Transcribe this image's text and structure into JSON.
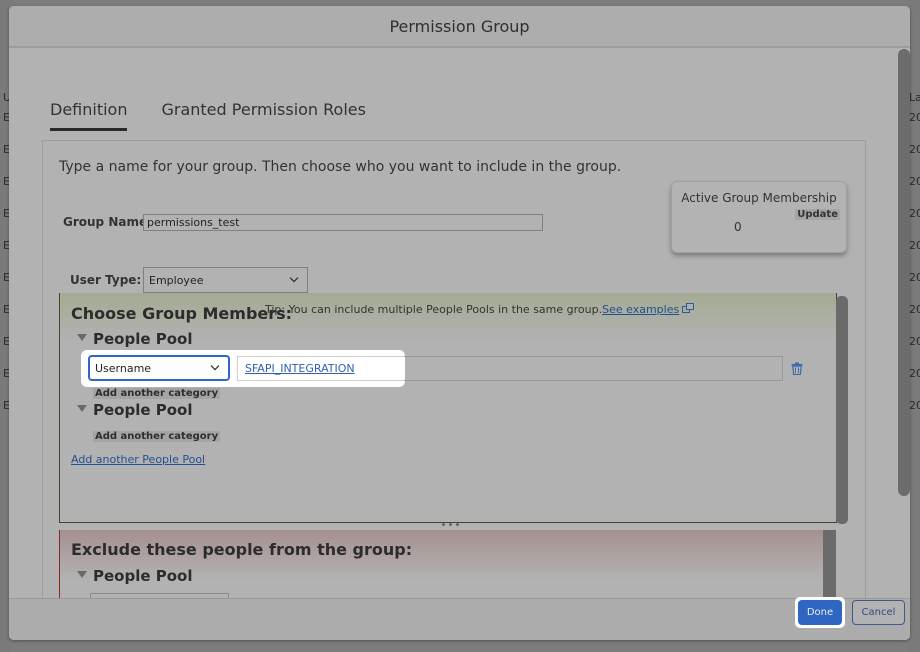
{
  "background": {
    "left_column": {
      "header": "U",
      "cells": [
        "E",
        "E",
        "E",
        "E",
        "E",
        "E",
        "E",
        "E",
        "E",
        "E"
      ]
    },
    "right_column": {
      "header": "La",
      "cells": [
        "20",
        "20",
        "20",
        "20",
        "20",
        "20",
        "20",
        "20",
        "20",
        "20"
      ]
    }
  },
  "dialog": {
    "title": "Permission Group",
    "tabs": [
      {
        "label": "Definition",
        "active": true
      },
      {
        "label": "Granted Permission Roles",
        "active": false
      }
    ],
    "intro": "Type a name for your group. Then choose who you want to include in the group.",
    "active_group_membership": {
      "title": "Active Group Membership",
      "update_label": "Update",
      "count": "0"
    },
    "group_name": {
      "label": "Group Name:",
      "value": "permissions_test"
    },
    "user_type": {
      "label": "User Type:",
      "selected": "Employee"
    },
    "include": {
      "heading": "Choose Group Members:",
      "tip": "Tip: You can include multiple People Pools in the same group.",
      "tip_link": "See examples",
      "pools": [
        {
          "title": "People Pool",
          "criteria": [
            {
              "category": "Username",
              "value": "SFAPI_INTEGRATION"
            }
          ],
          "add_category_label": "Add another category"
        },
        {
          "title": "People Pool",
          "criteria": [],
          "add_category_label": "Add another category"
        }
      ],
      "add_pool_label": "Add another People Pool"
    },
    "exclude": {
      "heading": "Exclude these people from the group:",
      "pools": [
        {
          "title": "People Pool"
        }
      ]
    },
    "footer": {
      "done_label": "Done",
      "cancel_label": "Cancel"
    }
  },
  "colors": {
    "primary": "#2f66c1",
    "link": "#234f93",
    "include_border": "#3a4a2c",
    "exclude_border": "#8a2a1f"
  }
}
